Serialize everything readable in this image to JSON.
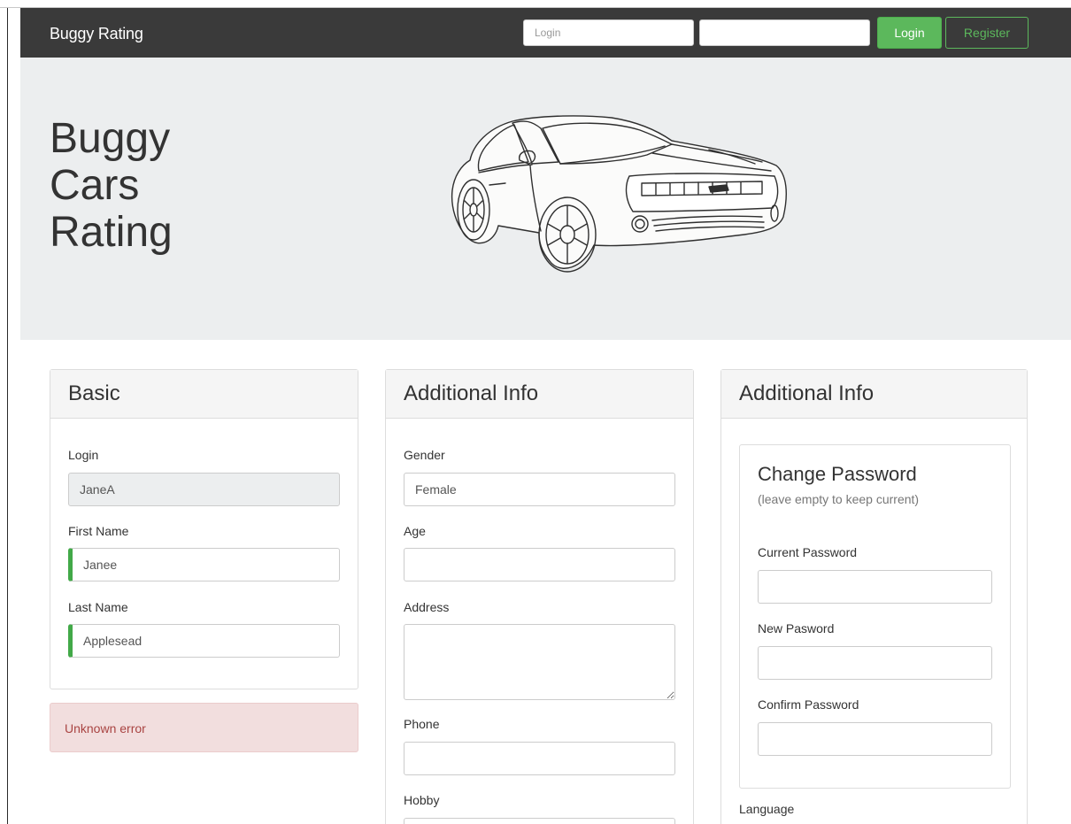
{
  "navbar": {
    "brand": "Buggy Rating",
    "login_placeholder": "Login",
    "password_placeholder": "",
    "login_button": "Login",
    "register_button": "Register"
  },
  "hero": {
    "title_lines": [
      "Buggy",
      "Cars",
      "Rating"
    ]
  },
  "basic": {
    "title": "Basic",
    "login_label": "Login",
    "login_value": "JaneA",
    "first_name_label": "First Name",
    "first_name_value": "Janee",
    "last_name_label": "Last Name",
    "last_name_value": "Applesead"
  },
  "error": {
    "message": "Unknown error"
  },
  "additional": {
    "title": "Additional Info",
    "gender_label": "Gender",
    "gender_value": "Female",
    "age_label": "Age",
    "age_value": "",
    "address_label": "Address",
    "address_value": "",
    "phone_label": "Phone",
    "phone_value": "",
    "hobby_label": "Hobby"
  },
  "additional2": {
    "title": "Additional Info",
    "change_password_title": "Change Password",
    "change_password_hint": "(leave empty to keep current)",
    "current_password_label": "Current Password",
    "new_password_label": "New Pasword",
    "confirm_password_label": "Confirm Password",
    "language_label": "Language"
  },
  "colors": {
    "navbar_bg": "#3a3a3a",
    "success_green": "#5cb85c",
    "valid_indicator": "#42a948",
    "jumbotron_bg": "#eceeef",
    "error_bg": "#f2dede",
    "error_text": "#a94442"
  }
}
